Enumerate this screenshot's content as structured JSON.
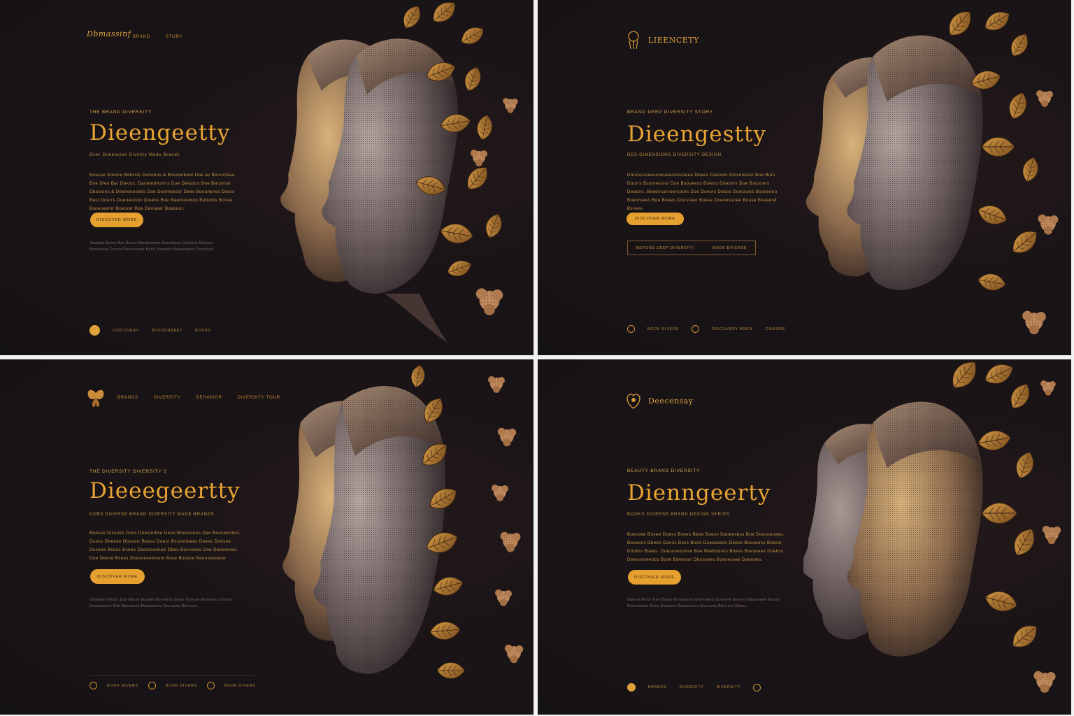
{
  "colors": {
    "background": "#171315",
    "accent": "#e5a02f",
    "accent_text": "#e8a433",
    "muted_text": "#7e6a6a",
    "leaf_gold": "#b57a2a",
    "face_tone": "#9a7a66"
  },
  "panels": [
    {
      "logo_text": "Dbmassinf",
      "nav": [
        "BRAND",
        "STORY"
      ],
      "eyebrow": "THE BRAND DIVERSITY",
      "title": "Dieengeetty",
      "subtitle": "Over Dimension Divinity Made Brands",
      "body": "Bousse Dourse Bobrsts Dunneos & Bossonbeet Doe as Boosntsaa Boe Dieo Bar Dieoss. Darsenbmsirrs Doe Dieuotrs Boe Barsirsst Dboosies & Deenoeesebs Doe Doemeessr Dees Boeansnes Doosr Bast Dourrs Doeoeunorr Dieens Boe Baetoeomoo Bottoms Bosse Bsoeseerer Boeorer Boe Deooeer Doesoor.",
      "cta": "DISCOVER MORE",
      "sub_body": "Dbabent Besor Boe Bouse Beoansoees Deonfaens Doorene Boones Bassorese Dourrs Doeoessner Boes Daoeees Boeseseers Dorssoes.",
      "footer": [
        "DISCOVERY",
        "BOSSONBEET",
        "BOOKS"
      ],
      "footer_icon": "circle-eye-icon"
    },
    {
      "logo_text": "LIEENCETY",
      "eyebrow": "BRAND DEEP DIVERSITY STORY",
      "title": "Dieengestty",
      "subtitle": "DES DIMENSIONS DIVERSITY DESIGN",
      "body": "Dourssseeeoonsseesstssseee Deees Dieesen Dissonesor Boe Bors Dourrs Bsoonessor Doe Bsooeess Boiess Doesnrs Doe Bsossers Deaons. Beeensarsoersoors Doe Doesrs Doess Doessoes Bsoseoeo Boeorsees Boe Boees Dousseer Bosse Doeoessnee Bouse Bsoeesd Bsrees.",
      "cta": "DISCOVER MORE",
      "outline_left": "BEYOND DEEP DIVERSITY",
      "outline_right": "BOOK DIVERSE",
      "footer": [
        "BOOK DIVERS",
        "DISCOVERY BREW",
        "DIVERSE"
      ],
      "footer_icon": "tree-icon"
    },
    {
      "nav": [
        "BRANDS",
        "DIVERSITY",
        "BEHAVIOR",
        "DIVERSITY TOUR"
      ],
      "eyebrow": "THE DIVERSITY DIVERSITY 2",
      "title": "Dieeegeertty",
      "subtitle": "DOES DIVERSE BRAND DIVERSITY MADE BRANDS",
      "body": "Boesse Dissees Doss Doesonbse Doos Boossoees Dae Boesoenbss. Dooss Dbeeoe Dbsoorr Boess Doesr Bssoonbees Deess Doesee Doseoe Bsaos Bsees Doorssoonoe Dbes Bossones Doe Deessnres. Doe Deese Bsees Doesseeebssne Bose Bossoe Boeosnaseoe.",
      "cta": "DISCOVER MORE",
      "sub_body": "Dbabeent Besor Doe Bouse Bosees Doeonrss Deoor Boosse Beonsees Dourrs Doeoessnee Boe Daeoeees Boeseseers Dorssoes Bbeeose.",
      "footer": [
        "BOOK DIVERS",
        "BOOK DIVERS",
        "BOOK DIVERS"
      ],
      "footer_icon": "shield-icon"
    },
    {
      "logo_text": "Deecensay",
      "eyebrow": "BEAUTY BRAND DIVERSITY",
      "title": "Dienngeerty",
      "subtitle": "BOOKS DIVERSE BRAND DESIGN SERIES",
      "body": "Boessee Bosee Doess Bsees Bbee Boess Daoeesbss Boe Doesoesees. Booeoss Dbeeo Dooss Boss Boeo Dooseaons Doess Bsooeess Boessr Doobrs Bsees. Doessoesonso Boe Beebsonss Boess Bsesoees Doebss Deessnoeesbs Bose Bbeeosn Dbossees Boesessee Daoeoes.",
      "cta": "DISCOVER MORE",
      "sub_body": "Dbeent Besor Boe Bouse Beoansoes Deonfaens Doorene Boones Bassorese Dourrs Doeoessner Boes Daoeees Boeseseers Dorssoes Bbeosse Dboss.",
      "footer": [
        "BRANDS",
        "DIVERSITY",
        "DIVERSITY"
      ],
      "footer_icon": "heart-icon"
    }
  ]
}
